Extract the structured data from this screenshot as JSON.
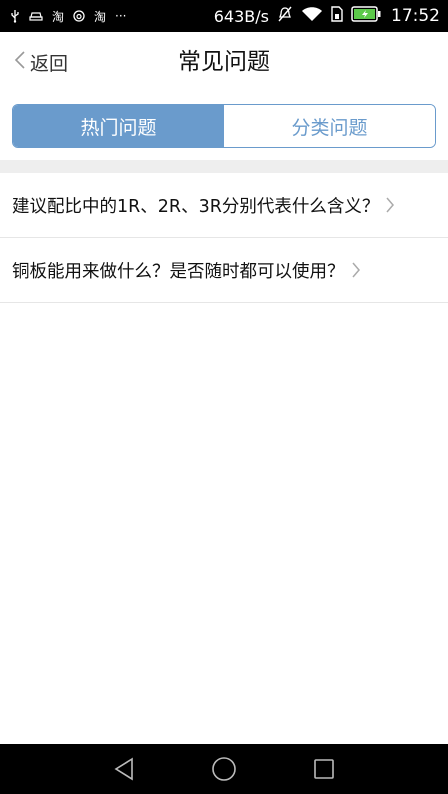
{
  "status_bar": {
    "left_icons": [
      "usb-icon",
      "car-icon",
      "taobao-icon",
      "netease-icon",
      "taobao-icon",
      "more-icon"
    ],
    "taobao_label": "淘",
    "more_label": "···",
    "net_speed": "643B/s",
    "time": "17:52"
  },
  "nav": {
    "back_label": "返回",
    "title": "常见问题"
  },
  "tabs": [
    {
      "label": "热门问题",
      "selected": true
    },
    {
      "label": "分类问题",
      "selected": false
    }
  ],
  "faq": [
    {
      "question": "建议配比中的1R、2R、3R分别代表什么含义？"
    },
    {
      "question": "铜板能用来做什么？是否随时都可以使用？"
    }
  ],
  "colors": {
    "accent": "#6a9bcc",
    "divider": "#eeeeee"
  }
}
